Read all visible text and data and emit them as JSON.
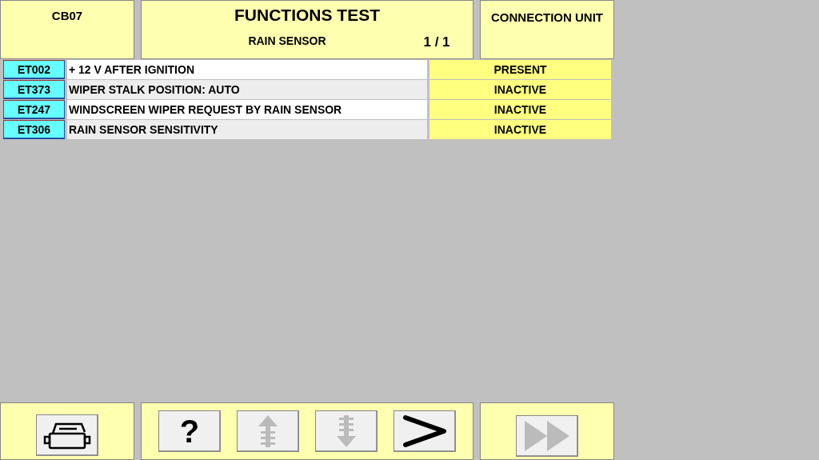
{
  "header": {
    "code": "CB07",
    "title": "FUNCTIONS TEST",
    "subtitle": "RAIN SENSOR",
    "page": "1 / 1",
    "unit": "CONNECTION UNIT"
  },
  "rows": [
    {
      "code": "ET002",
      "label": "+ 12 V AFTER IGNITION",
      "status": "PRESENT"
    },
    {
      "code": "ET373",
      "label": "WIPER STALK POSITION: AUTO",
      "status": "INACTIVE"
    },
    {
      "code": "ET247",
      "label": "WINDSCREEN WIPER REQUEST BY RAIN SENSOR",
      "status": "INACTIVE"
    },
    {
      "code": "ET306",
      "label": "RAIN SENSOR SENSITIVITY",
      "status": "INACTIVE"
    }
  ],
  "toolbar": {
    "left": [
      {
        "kind": "print",
        "disabled": false
      }
    ],
    "center": [
      {
        "kind": "help",
        "label": "?",
        "disabled": false
      },
      {
        "kind": "up",
        "disabled": true
      },
      {
        "kind": "down",
        "disabled": true
      },
      {
        "kind": "next",
        "disabled": false
      }
    ],
    "right": [
      {
        "kind": "skip",
        "disabled": true
      }
    ]
  }
}
